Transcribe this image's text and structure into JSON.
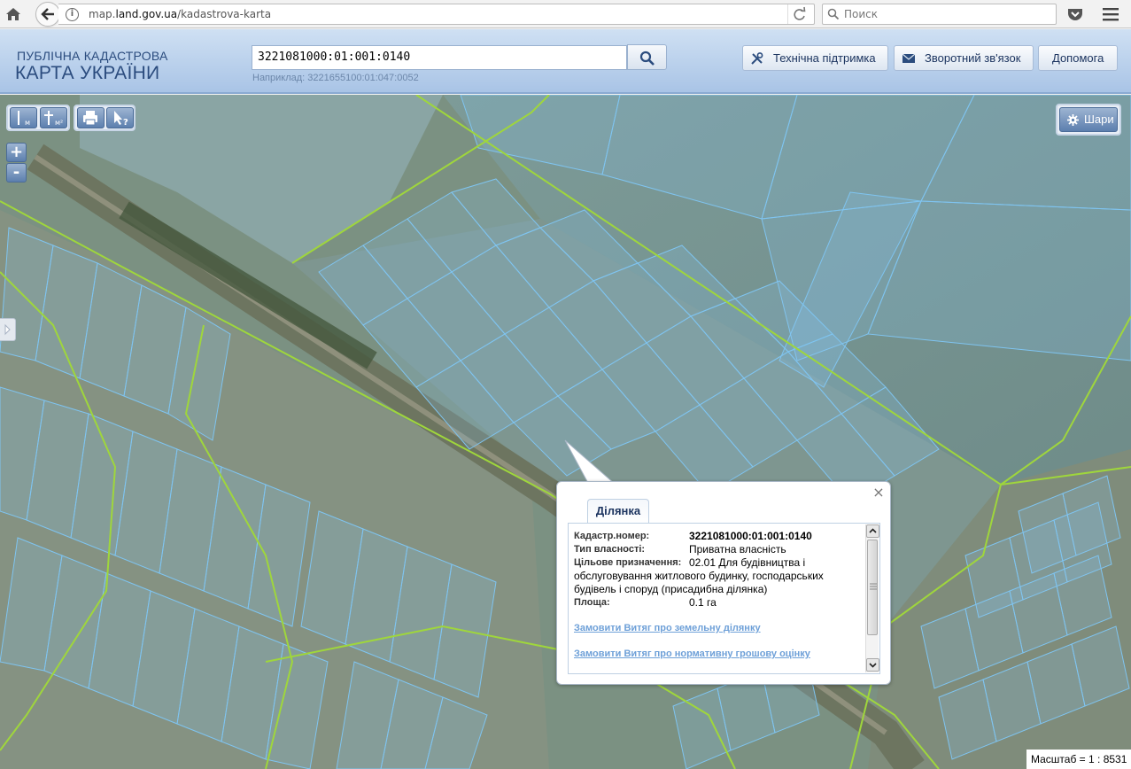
{
  "browser": {
    "url_prefix": "map.",
    "url_domain": "land.gov.ua",
    "url_path": "/kadastrova-karta",
    "search_placeholder": "Поиск"
  },
  "header": {
    "logo_line1": "ПУБЛІЧНА КАДАСТРОВА",
    "logo_line2": "КАРТА УКРАЇНИ",
    "search_value": "3221081000:01:001:0140",
    "example": "Наприклад: 3221655100:01:047:0052",
    "buttons": {
      "support": "Технічна підтримка",
      "feedback": "Зворотний зв'язок",
      "help": "Допомога"
    }
  },
  "map": {
    "layers_label": "Шари",
    "zoom_in": "+",
    "zoom_out": "-",
    "scale": "Масштаб = 1 : 8531",
    "tools": [
      "ruler-length-icon",
      "ruler-area-icon",
      "print-icon",
      "identify-icon"
    ]
  },
  "popup": {
    "tab": "Ділянка",
    "close": "×",
    "fields": {
      "cadastral_label": "Кадастр.номер:",
      "cadastral_value": "3221081000:01:001:0140",
      "ownership_label": "Тип власності:",
      "ownership_value": "Приватна власність",
      "purpose_label": "Цільове призначення:",
      "purpose_value_1": "02.01 Для будівництва і",
      "purpose_value_2": "обслуговування житлового будинку, господарських",
      "purpose_value_3": "будівель і споруд (присадибна ділянка)",
      "area_label": "Площа:",
      "area_value": "0.1 га"
    },
    "links": {
      "extract_land": "Замовити Витяг про земельну ділянку",
      "extract_valuation": "Замовити Витяг про нормативну грошову оцінку"
    }
  },
  "colors": {
    "parcel_outline": "#7fc4f0",
    "boundary_line": "#9fd63c",
    "header_blue": "#2b4c7e"
  }
}
